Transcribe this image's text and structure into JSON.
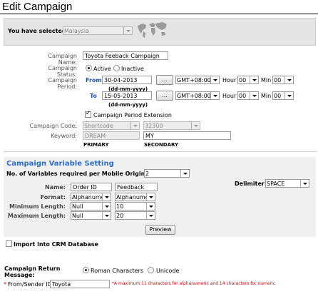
{
  "page": {
    "title": "Edit Campaign"
  },
  "selection": {
    "label": "You have selected:",
    "country": "Malaysia"
  },
  "campaign": {
    "name_label": "Campaign Name:",
    "name_value": "Toyota Feeback Campaign",
    "status_label": "Campaign Status:",
    "status_active": "Active",
    "status_inactive": "Inactive",
    "period_label": "Campaign Period:",
    "from_label": "From",
    "from_date": "30-04-2013",
    "to_label": "To",
    "to_date": "15-05-2013",
    "date_hint": "(dd-mm-yyyy)",
    "browse_label": "...",
    "timezone": "GMT+08:00",
    "hour_label": "Hour",
    "min_label": "Min",
    "hour_value": "00",
    "min_value": "00",
    "extension_label": "Campaign Period Extension",
    "code_label": "Campaign Code:",
    "code_type": "Shortcode",
    "code_value": "32300",
    "keyword_label": "Keyword:",
    "keyword_primary": "DREAM",
    "keyword_secondary": "MY",
    "primary_caption": "PRIMARY",
    "secondary_caption": "SECONDARY"
  },
  "variables": {
    "heading": "Campaign Variable Setting",
    "count_label": "No. of Variables required per Mobile Originating:",
    "count_value": "2",
    "delimiter_label": "Delimiter :",
    "delimiter_value": "SPACE",
    "name_label": "Name:",
    "format_label": "Format:",
    "min_label": "Minimum Length:",
    "max_label": "Maximum Length:",
    "var1": {
      "name": "Order ID",
      "format": "Alphanumeric",
      "min": "Null",
      "max": "Null"
    },
    "var2": {
      "name": "Feedback",
      "format": "Alphanumeric",
      "min": "10",
      "max": "20"
    },
    "preview_label": "Preview"
  },
  "crm": {
    "label": "Import into CRM Database"
  },
  "return_msg": {
    "label_line1": "Campaign Return",
    "label_line2": "Message:",
    "roman": "Roman Characters",
    "unicode": "Unicode",
    "sender_label": "From/Sender ID :",
    "required_mark": "*",
    "sender_value": "Toyota",
    "sender_note": "*A maximum 11 characters for alphanumeric and 14 characters for numeric"
  }
}
